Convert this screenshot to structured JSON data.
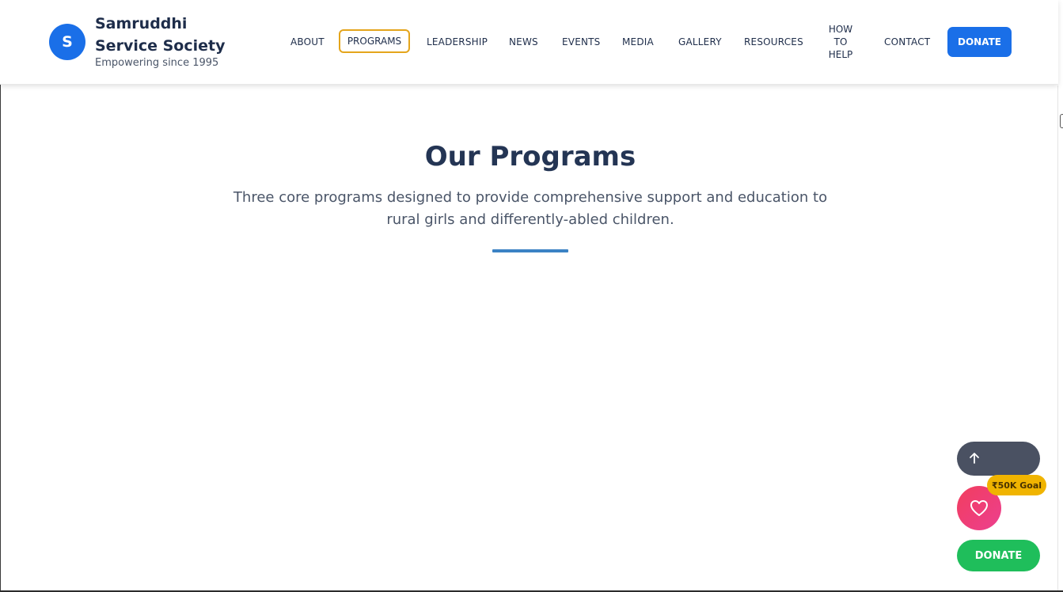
{
  "header": {
    "logo_letter": "S",
    "org_name": "Samruddhi Service Society",
    "tagline": "Empowering since 1995",
    "nav": {
      "about": "ABOUT",
      "programs": "PROGRAMS",
      "leadership": "LEADERSHIP",
      "news": "NEWS",
      "events": "EVENTS",
      "media": "MEDIA",
      "gallery": "GALLERY",
      "resources": "RESOURCES",
      "how_to_help_line1": "HOW",
      "how_to_help_line2": "TO",
      "how_to_help_line3": "HELP",
      "contact": "CONTACT"
    },
    "donate_label": "DONATE"
  },
  "main": {
    "title": "Our Programs",
    "subtitle_line1": "Three core programs designed to provide comprehensive support and education to",
    "subtitle_line2": "rural girls and differently-abled children."
  },
  "floating": {
    "goal_badge": "₹50K Goal",
    "donate_label": "DONATE"
  },
  "colors": {
    "brand_blue": "#1a6fe8",
    "active_nav_outline": "#e4a51c",
    "heading": "#243554",
    "divider": "#3b82c4",
    "goal_badge": "#f0b400",
    "heart_button": "#ef3e6f",
    "float_donate": "#1fbe5b",
    "scroll_top_button": "#4a5162"
  },
  "icons": {
    "scroll_top": "arrow-up-icon",
    "heart": "heart-icon"
  }
}
